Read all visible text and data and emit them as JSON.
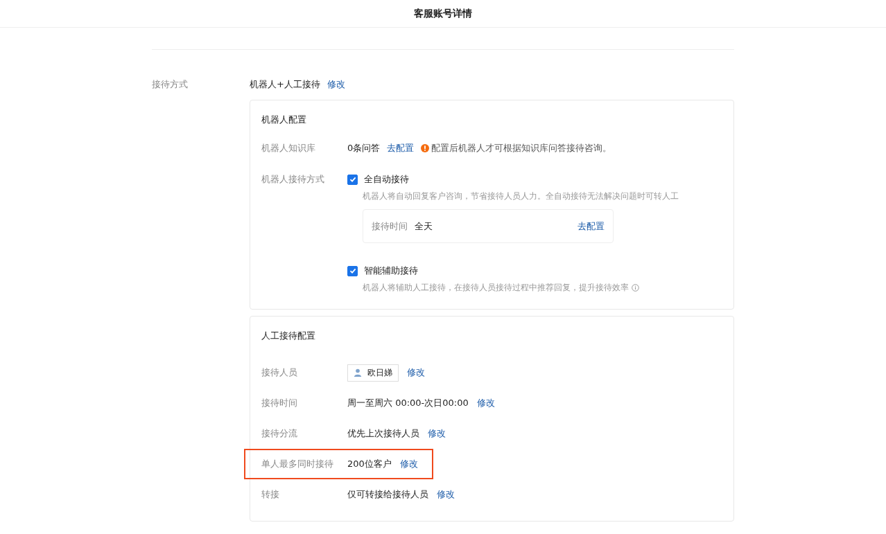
{
  "header": {
    "title": "客服账号详情"
  },
  "reception_mode": {
    "label": "接待方式",
    "value": "机器人+人工接待",
    "action": "修改"
  },
  "robot_config": {
    "title": "机器人配置",
    "knowledge_base": {
      "label": "机器人知识库",
      "value": "0条问答",
      "action": "去配置",
      "warning": "配置后机器人才可根据知识库问答接待咨询。"
    },
    "mode": {
      "label": "机器人接待方式",
      "options": [
        {
          "label": "全自动接待",
          "checked": true,
          "description": "机器人将自动回复客户咨询，节省接待人员人力。全自动接待无法解决问题时可转人工",
          "time": {
            "label": "接待时间",
            "value": "全天",
            "action": "去配置"
          }
        },
        {
          "label": "智能辅助接待",
          "checked": true,
          "description": "机器人将辅助人工接待，在接待人员接待过程中推荐回复，提升接待效率"
        }
      ]
    }
  },
  "human_config": {
    "title": "人工接待配置",
    "rows": [
      {
        "kind": "person",
        "label": "接待人员",
        "value": "欧日娣",
        "action": "修改",
        "highlighted": false
      },
      {
        "kind": "text",
        "label": "接待时间",
        "value": "周一至周六 00:00-次日00:00",
        "action": "修改",
        "highlighted": false
      },
      {
        "kind": "text",
        "label": "接待分流",
        "value": "优先上次接待人员",
        "action": "修改",
        "highlighted": false
      },
      {
        "kind": "text",
        "label": "单人最多同时接待",
        "value": "200位客户",
        "action": "修改",
        "highlighted": true
      },
      {
        "kind": "text",
        "label": "转接",
        "value": "仅可转接给接待人员",
        "action": "修改",
        "highlighted": false
      }
    ]
  }
}
